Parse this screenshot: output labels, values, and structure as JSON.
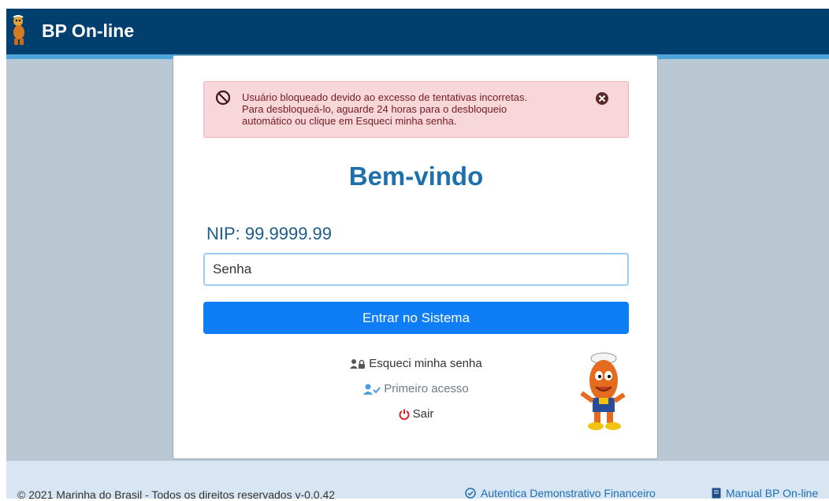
{
  "header": {
    "title": "BP On-line",
    "logo_icon": "mascot-logo-icon",
    "background": "#003f6e"
  },
  "alert": {
    "icon": "ban-icon",
    "lines": [
      "Usuário bloqueado devido ao excesso de tentativas incorretas.",
      "Para desbloqueá-lo, aguarde 24 horas para o desbloqueio",
      "automático ou clique em Esqueci minha senha."
    ],
    "close_icon": "close-icon"
  },
  "login": {
    "welcome": "Bem-vindo",
    "nip": "NIP: 99.9999.99",
    "password_placeholder": "Senha",
    "submit_label": "Entrar no Sistema",
    "accent": "#0d7ef5"
  },
  "links": {
    "forgot_label": "Esqueci minha senha",
    "first_access_label": "Primeiro acesso",
    "exit_label": "Sair"
  },
  "footer": {
    "copyright": "© 2021 Marinha do Brasil - Todos os direitos reservados v-0.0.42",
    "authenticate_label": "Autentica Demonstrativo Financeiro",
    "manual_label": "Manual BP On-line"
  }
}
